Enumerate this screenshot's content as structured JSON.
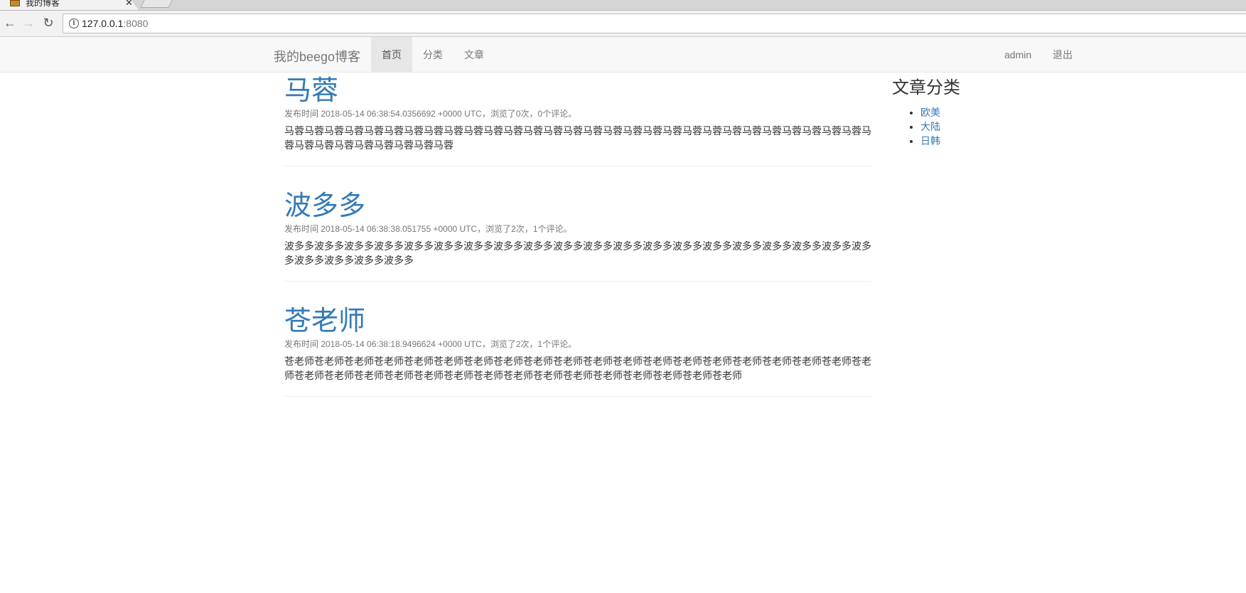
{
  "browser": {
    "tab_title": "我的博客",
    "url_host": "127.0.0.1",
    "url_port": ":8080"
  },
  "navbar": {
    "brand": "我的beego博客",
    "links": [
      {
        "label": "首页",
        "active": true
      },
      {
        "label": "分类",
        "active": false
      },
      {
        "label": "文章",
        "active": false
      }
    ],
    "user": "admin",
    "logout": "退出"
  },
  "articles": [
    {
      "title": "马蓉",
      "meta": "发布时间 2018-05-14 06:38:54.0356692 +0000 UTC，浏览了0次，0个评论。",
      "body": "马蓉马蓉马蓉马蓉马蓉马蓉马蓉马蓉马蓉马蓉马蓉马蓉马蓉马蓉马蓉马蓉马蓉马蓉马蓉马蓉马蓉马蓉马蓉马蓉马蓉马蓉马蓉马蓉马蓉马蓉马蓉马蓉马蓉马蓉马蓉马蓉马蓉马蓉"
    },
    {
      "title": "波多多",
      "meta": "发布时间 2018-05-14 06:38:38.051755 +0000 UTC，浏览了2次，1个评论。",
      "body": "波多多波多多波多多波多多波多多波多多波多多波多多波多多波多多波多多波多多波多多波多多波多多波多多波多多波多多波多多波多多波多多波多多波多多波多多"
    },
    {
      "title": "苍老师",
      "meta": "发布时间 2018-05-14 06:38:18.9496624 +0000 UTC，浏览了2次，1个评论。",
      "body": "苍老师苍老师苍老师苍老师苍老师苍老师苍老师苍老师苍老师苍老师苍老师苍老师苍老师苍老师苍老师苍老师苍老师苍老师苍老师苍老师苍老师苍老师苍老师苍老师苍老师苍老师苍老师苍老师苍老师苍老师苍老师苍老师苍老师苍老师苍老师"
    }
  ],
  "sidebar": {
    "title": "文章分类",
    "categories": [
      "欧美",
      "大陆",
      "日韩"
    ]
  },
  "colors": {
    "link": "#337ab7",
    "navbar_bg": "#f8f8f8",
    "active_nav_bg": "#e7e7e7"
  }
}
